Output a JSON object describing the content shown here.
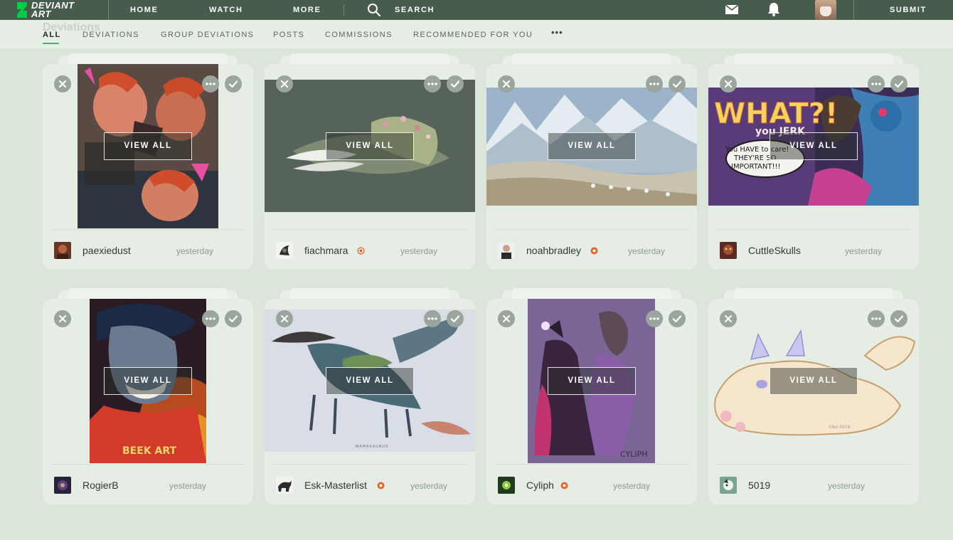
{
  "header": {
    "logo_text_1": "DEVIANT",
    "logo_text_2": "ART",
    "nav": [
      "HOME",
      "WATCH",
      "MORE"
    ],
    "search_label": "SEARCH",
    "submit_label": "SUBMIT"
  },
  "page": {
    "ghost_title": "Deviations"
  },
  "tabs": [
    "ALL",
    "DEVIATIONS",
    "GROUP DEVIATIONS",
    "POSTS",
    "COMMISSIONS",
    "RECOMMENDED FOR YOU"
  ],
  "tabs_more": "•••",
  "view_all_label": "VIEW ALL",
  "colors": {
    "topbar": "#475c4d",
    "accent_green": "#3ab86b",
    "core_badge": "#e8622c",
    "card_bg": "#e6ede5",
    "page_bg": "#dbe5da"
  },
  "cards": [
    {
      "username": "paexiedust",
      "time": "yesterday",
      "core_badge": false
    },
    {
      "username": "fiachmara",
      "time": "yesterday",
      "core_badge": true
    },
    {
      "username": "noahbradley",
      "time": "yesterday",
      "core_badge": true
    },
    {
      "username": "CuttleSkulls",
      "time": "yesterday",
      "core_badge": false
    },
    {
      "username": "RogierB",
      "time": "yesterday",
      "core_badge": false
    },
    {
      "username": "Esk-Masterlist",
      "time": "yesterday",
      "core_badge": true
    },
    {
      "username": "Cyliph",
      "time": "yesterday",
      "core_badge": true
    },
    {
      "username": "5019",
      "time": "yesterday",
      "core_badge": false
    }
  ],
  "artwork_text": {
    "comic_title": "WHAT?!",
    "comic_sub": "you JERK",
    "comic_bubble_1": "You HAVE to care!",
    "comic_bubble_2": "THEY'RE SO",
    "comic_bubble_3": "IMPORTANT!!!",
    "beek_signature": "BEEK ART",
    "mamasaurus_signature": "MAMASAURUS",
    "cyliph_signature": "CYLIPH",
    "pup_signature": "kiko-5019"
  }
}
